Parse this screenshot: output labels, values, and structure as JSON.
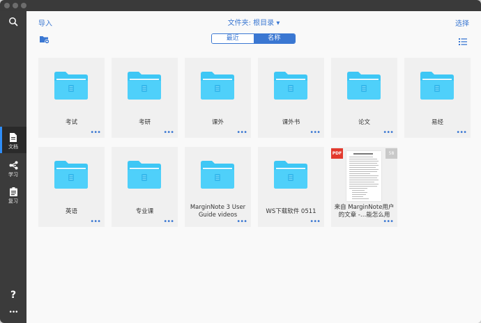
{
  "sidebar": {
    "items": [
      {
        "label": "文档",
        "icon": "document-icon",
        "active": true
      },
      {
        "label": "学习",
        "icon": "study-branch-icon",
        "active": false
      },
      {
        "label": "复习",
        "icon": "review-cards-icon",
        "active": false
      }
    ],
    "help_icon": "?",
    "more_icon": "•••"
  },
  "header": {
    "import_label": "导入",
    "folder_title": "文件夹: 根目录 ▾",
    "select_label": "选择"
  },
  "sort": {
    "recent_label": "最近",
    "name_label": "名称",
    "selected": "名称"
  },
  "items": [
    {
      "name": "考试"
    },
    {
      "name": "考研"
    },
    {
      "name": "课外"
    },
    {
      "name": "课外书"
    },
    {
      "name": "论文"
    },
    {
      "name": "易经"
    },
    {
      "name": "英语"
    },
    {
      "name": "专业课"
    },
    {
      "name": "MarginNote 3 User Guide videos"
    },
    {
      "name": "WS下载软件 0511"
    }
  ],
  "document": {
    "name_line1": "来自 MarginNote用户",
    "name_line2": "的文章 -…能怎么用",
    "type_badge": "PDF",
    "count_badge": "58"
  },
  "more_dots": "•••",
  "colors": {
    "accent": "#3a77d2",
    "folder": "#3ec7f5",
    "sidebar": "#3b3b3b",
    "pdf": "#e23a2e"
  }
}
